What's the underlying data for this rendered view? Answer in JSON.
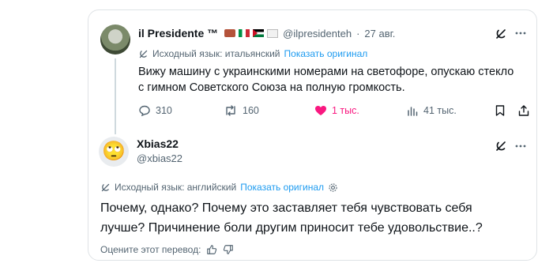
{
  "original_tweet": {
    "display_name": "il Presidente ™",
    "handle": "@ilpresidenteh",
    "separator": "·",
    "date": "27 авг.",
    "translation_note": "Исходный язык: итальянский",
    "show_original": "Показать оригинал",
    "text_line1": "Вижу машину с украинскими номерами на светофоре, опускаю стекло",
    "text_line2": "с гимном Советского Союза на полную громкость.",
    "replies": "310",
    "reposts": "160",
    "likes": "1 тыс.",
    "views": "41 тыс.",
    "colors": {
      "like": "#f91880",
      "text": "#0f1419",
      "muted": "#536471",
      "link": "#1d9bf0"
    }
  },
  "reply_tweet": {
    "display_name": "Xbias22",
    "handle": "@xbias22",
    "avatar_emoji": "🙄",
    "translation_note": "Исходный язык: английский",
    "show_original": "Показать оригинал",
    "text_line1": "Почему, однако? Почему это заставляет тебя чувствовать себя",
    "text_line2": "лучше? Причинение боли другим приносит тебе удовольствие..?",
    "rate_translation": "Оцените этот перевод:"
  }
}
